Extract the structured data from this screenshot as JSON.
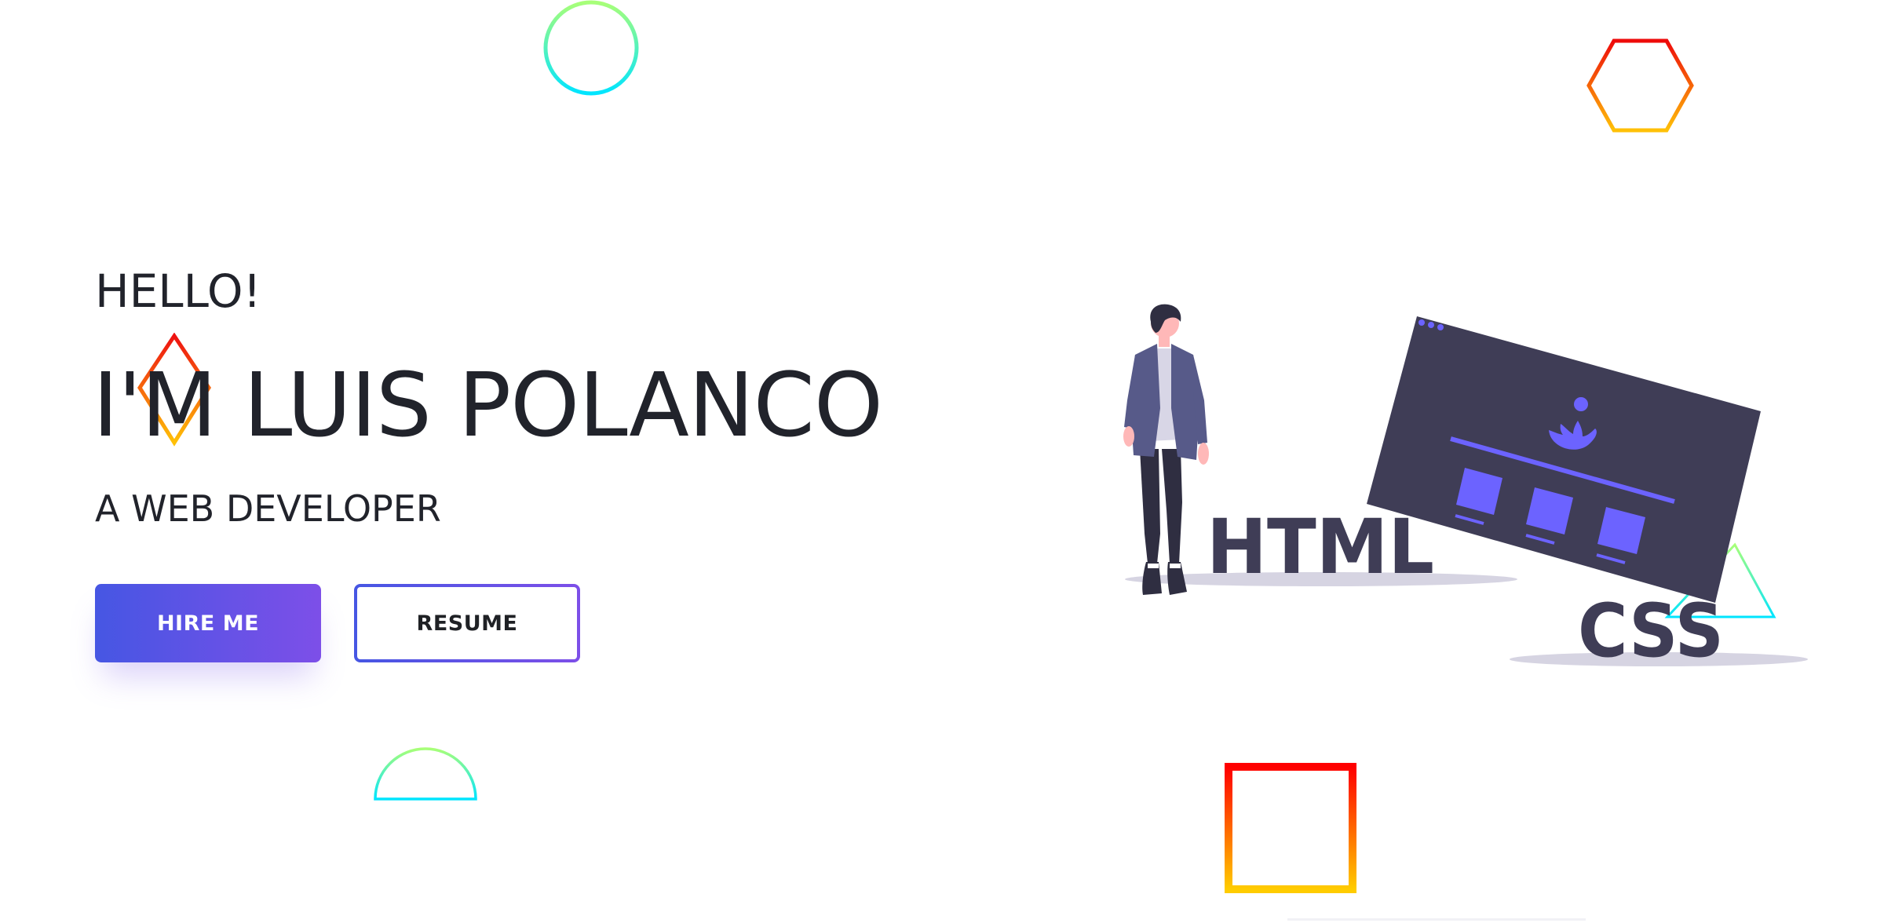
{
  "hero": {
    "greeting": "HELLO!",
    "name": "I'M LUIS POLANCO",
    "role": "A WEB DEVELOPER",
    "hire_label": "HIRE ME",
    "resume_label": "RESUME"
  },
  "illustration": {
    "html_label": "HTML",
    "css_label": "CSS"
  },
  "colors": {
    "accent_start": "#4656e3",
    "accent_end": "#7d4fe8",
    "text": "#21232b",
    "screen_dark": "#3f3d56",
    "screen_accent": "#6c63ff"
  }
}
